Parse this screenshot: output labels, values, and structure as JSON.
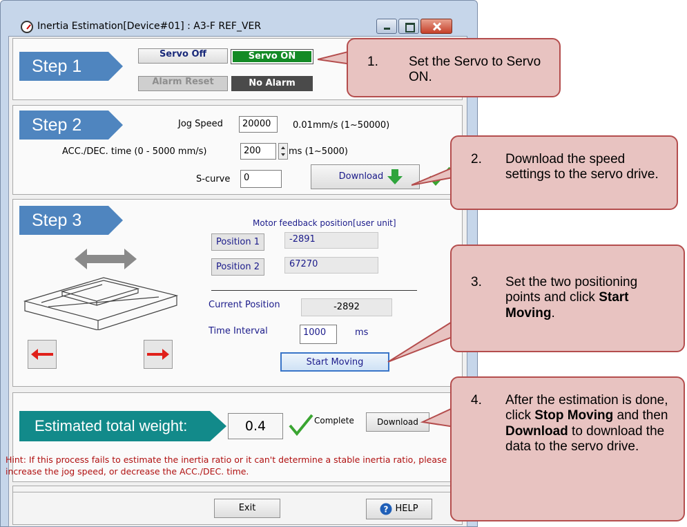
{
  "window": {
    "title": "Inertia Estimation[Device#01] : A3-F REF_VER"
  },
  "step1": {
    "step_label": "Step 1",
    "servo_off": "Servo Off",
    "servo_on": "Servo ON",
    "alarm_reset": "Alarm Reset",
    "alarm_status": "No Alarm"
  },
  "step2": {
    "step_label": "Step 2",
    "jog_speed_label": "Jog Speed",
    "jog_speed_value": "20000",
    "jog_speed_unit": "0.01mm/s (1~50000)",
    "acc_label": "ACC./DEC. time (0 - 5000 mm/s)",
    "acc_value": "200",
    "acc_unit": "ms (1~5000)",
    "scurve_label": "S-curve",
    "scurve_value": "0",
    "download": "Download"
  },
  "step3": {
    "step_label": "Step 3",
    "feedback_title": "Motor feedback position[user unit]",
    "position1_label": "Position 1",
    "position1_value": "-2891",
    "position2_label": "Position 2",
    "position2_value": "67270",
    "current_position_label": "Current Position",
    "current_position_value": "-2892",
    "time_interval_label": "Time Interval",
    "time_interval_value": "1000",
    "time_interval_unit": "ms",
    "start_moving": "Start Moving"
  },
  "weight": {
    "label": "Estimated total weight:",
    "value": "0.4",
    "status": "Complete",
    "download": "Download",
    "hint": "Hint: If this process fails to estimate the inertia ratio or it can't determine a stable inertia ratio, please increase the jog speed, or decrease the ACC./DEC. time."
  },
  "footer": {
    "exit": "Exit",
    "help": "HELP"
  },
  "callouts": {
    "c1_num": "1.",
    "c1_text": "Set the Servo to Servo ON.",
    "c2_num": "2.",
    "c2_text": "Download the speed settings to the servo drive.",
    "c3_num": "3.",
    "c3_text_a": "Set the two positioning points and click ",
    "c3_bold": "Start Moving",
    "c3_text_b": ".",
    "c4_num": "4.",
    "c4_text_a": "After the estimation is done, click ",
    "c4_bold_a": "Stop Moving",
    "c4_text_b": " and then ",
    "c4_bold_b": "Download",
    "c4_text_c": " to download the data to the servo drive."
  },
  "colors": {
    "step_blue": "#4f85bf",
    "servo_on_green": "#138a25",
    "banner_teal": "#128a8a",
    "hint_red": "#b01010",
    "callout_fill": "#e8c3c1",
    "callout_border": "#b44d4d",
    "check_green": "#3aa532"
  }
}
